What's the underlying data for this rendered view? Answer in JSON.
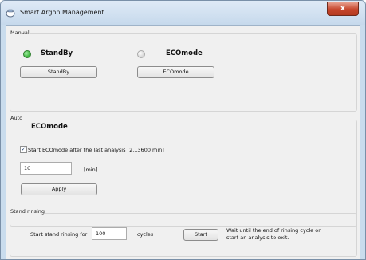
{
  "window": {
    "title": "Smart Argon Management",
    "close_glyph": "x"
  },
  "manual": {
    "group_label": "Manual",
    "standby": {
      "led_color": "#3fb63f",
      "label": "StandBy",
      "button_label": "StandBy"
    },
    "ecomode": {
      "led_color": "#d9d9d9",
      "label": "ECOmode",
      "button_label": "ECOmode"
    }
  },
  "auto": {
    "group_label": "Auto",
    "mode_label": "ECOmode",
    "checkbox_checked": true,
    "checkbox_glyph": "✓",
    "checkbox_label": "Start ECOmode after the last analysis [2...3600 min]",
    "minutes_value": "10",
    "minutes_unit": "[min]",
    "apply_label": "Apply"
  },
  "rinsing": {
    "group_label": "Stand rinsing",
    "prefix_label": "Start stand rinsing for",
    "cycles_value": "100",
    "cycles_unit": "cycles",
    "start_label": "Start",
    "hint_line1": "Wait until the end of rinsing cycle or",
    "hint_line2": "start an analysis to exit."
  },
  "colors": {
    "led_on": "#3fb63f",
    "led_off": "#d9d9d9",
    "close_button": "#c6462c"
  }
}
